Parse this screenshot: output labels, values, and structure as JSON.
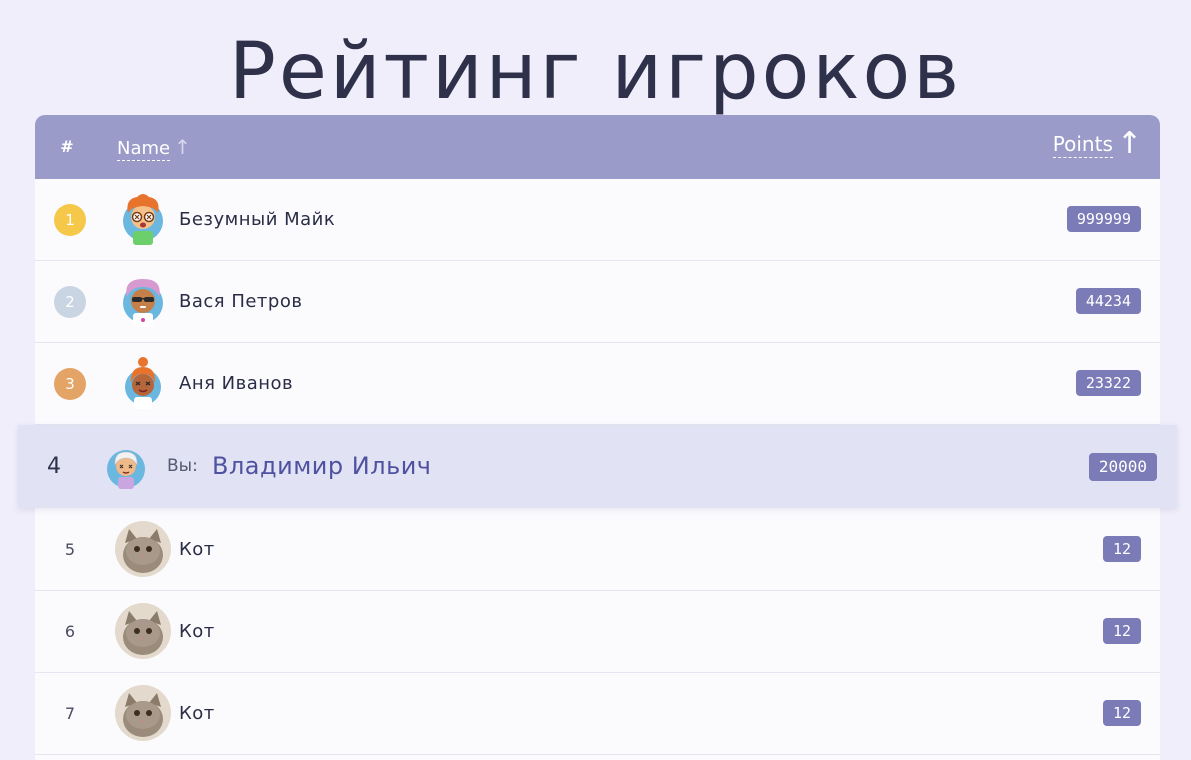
{
  "title": "Рейтинг игроков",
  "header": {
    "rank": "#",
    "name": "Name",
    "name_arrow": "↑",
    "points": "Points",
    "points_arrow": "↑"
  },
  "colors": {
    "gold": "#f5c84a",
    "silver": "#c9d5e2",
    "bronze": "#e3a466",
    "badge": "#7b7bb8",
    "header": "#9a9bc8"
  },
  "rows": [
    {
      "rank": "1",
      "name": "Безумный Майк",
      "points": "999999",
      "avatar": "orange-hair-glasses-avatar"
    },
    {
      "rank": "2",
      "name": "Вася Петров",
      "points": "44234",
      "avatar": "purple-hair-sunglasses-avatar"
    },
    {
      "rank": "3",
      "name": "Аня Иванов",
      "points": "23322",
      "avatar": "orange-bun-avatar"
    }
  ],
  "me": {
    "rank": "4",
    "prefix": "Вы:",
    "name": "Владимир Ильич",
    "points": "20000",
    "avatar": "white-hair-avatar"
  },
  "rows_after": [
    {
      "rank": "5",
      "name": "Кот",
      "points": "12",
      "avatar": "cat-avatar"
    },
    {
      "rank": "6",
      "name": "Кот",
      "points": "12",
      "avatar": "cat-avatar"
    },
    {
      "rank": "7",
      "name": "Кот",
      "points": "12",
      "avatar": "cat-avatar"
    }
  ]
}
